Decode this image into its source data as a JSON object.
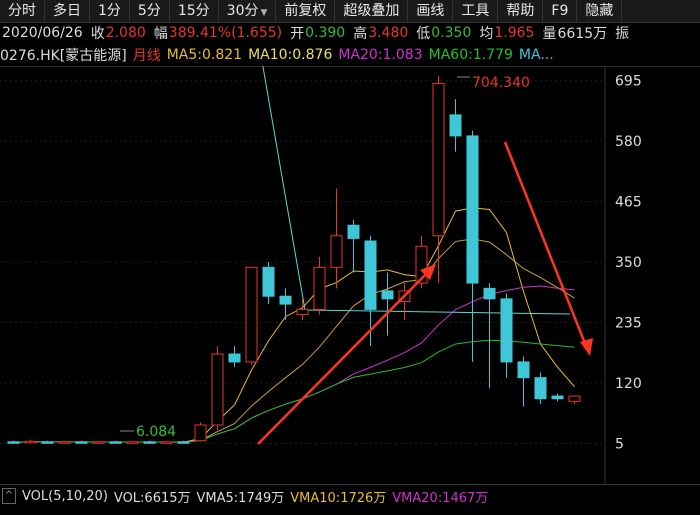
{
  "toolbar": {
    "items": [
      "分时",
      "多日",
      "1分",
      "5分",
      "15分",
      "30分",
      "前复权",
      "超级叠加",
      "画线",
      "工具",
      "帮助",
      "F9",
      "隐藏"
    ]
  },
  "info": {
    "date": "2020/06/26",
    "close_label": "收",
    "close": "2.080",
    "range_label": "幅",
    "range": "389.41%(1.655)",
    "open_label": "开",
    "open": "0.390",
    "high_label": "高",
    "high": "3.480",
    "low_label": "低",
    "low": "0.350",
    "avg_label": "均",
    "avg": "1.965",
    "vol_label": "量",
    "vol": "6615万",
    "amp_label": "振"
  },
  "ma": {
    "stock": "0276.HK[蒙古能源]",
    "period": "月线",
    "ma5": "MA5:0.821",
    "ma10": "MA10:0.876",
    "ma20": "MA20:1.083",
    "ma60": "MA60:1.779",
    "ma_more": "MA..."
  },
  "chart": {
    "y_ticks": [
      "695",
      "580",
      "465",
      "350",
      "235",
      "120",
      "5"
    ],
    "high_label": "704.340",
    "low_label": "6.084"
  },
  "volume": {
    "btn": "^",
    "vol_title": "VOL(5,10,20)",
    "vol": "VOL:6615万",
    "vma5": "VMA5:1749万",
    "vma10": "VMA10:1726万",
    "vma20": "VMA20:1467万"
  },
  "colors": {
    "up": "#e8352a",
    "down": "#3fc7d8",
    "ma5": "#f2f2f2",
    "ma10": "#e8c020",
    "ma20": "#d030d0",
    "ma60": "#22c022",
    "arrow": "#ff3322",
    "price_red": "#e8352a",
    "price_green": "#30c030"
  },
  "chart_data": {
    "type": "candlestick",
    "y_ticks": [
      695,
      580,
      465,
      350,
      235,
      120,
      5
    ],
    "candles": [
      {
        "o": 8,
        "h": 10,
        "l": 5,
        "c": 7
      },
      {
        "o": 7,
        "h": 12,
        "l": 5,
        "c": 9
      },
      {
        "o": 8,
        "h": 10,
        "l": 6,
        "c": 7
      },
      {
        "o": 7,
        "h": 9,
        "l": 5,
        "c": 8
      },
      {
        "o": 8,
        "h": 10,
        "l": 6,
        "c": 7
      },
      {
        "o": 7,
        "h": 9,
        "l": 5,
        "c": 8
      },
      {
        "o": 8,
        "h": 10,
        "l": 6,
        "c": 7
      },
      {
        "o": 7,
        "h": 9,
        "l": 6,
        "c": 8
      },
      {
        "o": 8,
        "h": 10,
        "l": 6,
        "c": 7
      },
      {
        "o": 7,
        "h": 9,
        "l": 5,
        "c": 8
      },
      {
        "o": 8,
        "h": 10,
        "l": 6,
        "c": 7
      },
      {
        "o": 10,
        "h": 45,
        "l": 8,
        "c": 40
      },
      {
        "o": 40,
        "h": 190,
        "l": 30,
        "c": 175
      },
      {
        "o": 175,
        "h": 190,
        "l": 150,
        "c": 160
      },
      {
        "o": 160,
        "h": 340,
        "l": 155,
        "c": 340
      },
      {
        "o": 340,
        "h": 350,
        "l": 270,
        "c": 285
      },
      {
        "o": 285,
        "h": 300,
        "l": 240,
        "c": 270
      },
      {
        "o": 250,
        "h": 280,
        "l": 240,
        "c": 260
      },
      {
        "o": 260,
        "h": 360,
        "l": 250,
        "c": 340
      },
      {
        "o": 340,
        "h": 490,
        "l": 300,
        "c": 400
      },
      {
        "o": 420,
        "h": 430,
        "l": 330,
        "c": 395
      },
      {
        "o": 390,
        "h": 400,
        "l": 190,
        "c": 260
      },
      {
        "o": 295,
        "h": 330,
        "l": 210,
        "c": 280
      },
      {
        "o": 275,
        "h": 310,
        "l": 240,
        "c": 295
      },
      {
        "o": 310,
        "h": 400,
        "l": 300,
        "c": 380
      },
      {
        "o": 400,
        "h": 704,
        "l": 310,
        "c": 690
      },
      {
        "o": 630,
        "h": 660,
        "l": 560,
        "c": 590
      },
      {
        "o": 590,
        "h": 600,
        "l": 160,
        "c": 310
      },
      {
        "o": 300,
        "h": 310,
        "l": 110,
        "c": 280
      },
      {
        "o": 280,
        "h": 290,
        "l": 130,
        "c": 160
      },
      {
        "o": 160,
        "h": 170,
        "l": 75,
        "c": 130
      },
      {
        "o": 130,
        "h": 140,
        "l": 80,
        "c": 90
      },
      {
        "o": 95,
        "h": 100,
        "l": 85,
        "c": 90
      },
      {
        "o": 85,
        "h": 95,
        "l": 80,
        "c": 95
      }
    ]
  }
}
